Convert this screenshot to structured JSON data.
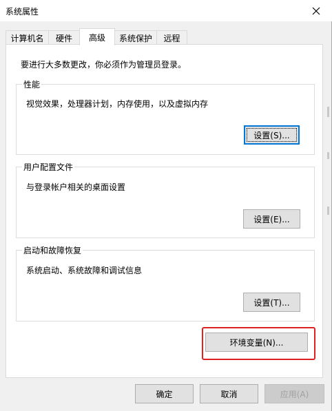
{
  "window": {
    "title": "系统属性"
  },
  "tabs": [
    {
      "label": "计算机名"
    },
    {
      "label": "硬件"
    },
    {
      "label": "高级"
    },
    {
      "label": "系统保护"
    },
    {
      "label": "远程"
    }
  ],
  "active_tab": "高级",
  "advanced": {
    "notice": "要进行大多数更改，你必须作为管理员登录。",
    "performance": {
      "title": "性能",
      "description": "视觉效果，处理器计划，内存使用，以及虚拟内存",
      "button": "设置(S)..."
    },
    "user_profiles": {
      "title": "用户配置文件",
      "description": "与登录帐户相关的桌面设置",
      "button": "设置(E)..."
    },
    "startup_recovery": {
      "title": "启动和故障恢复",
      "description": "系统启动、系统故障和调试信息",
      "button": "设置(T)..."
    },
    "env_button": "环境变量(N)..."
  },
  "footer": {
    "ok": "确定",
    "cancel": "取消",
    "apply": "应用(A)"
  },
  "icons": {
    "close": "close-icon"
  },
  "colors": {
    "highlight": "#e02020",
    "focus": "#0078d7"
  }
}
